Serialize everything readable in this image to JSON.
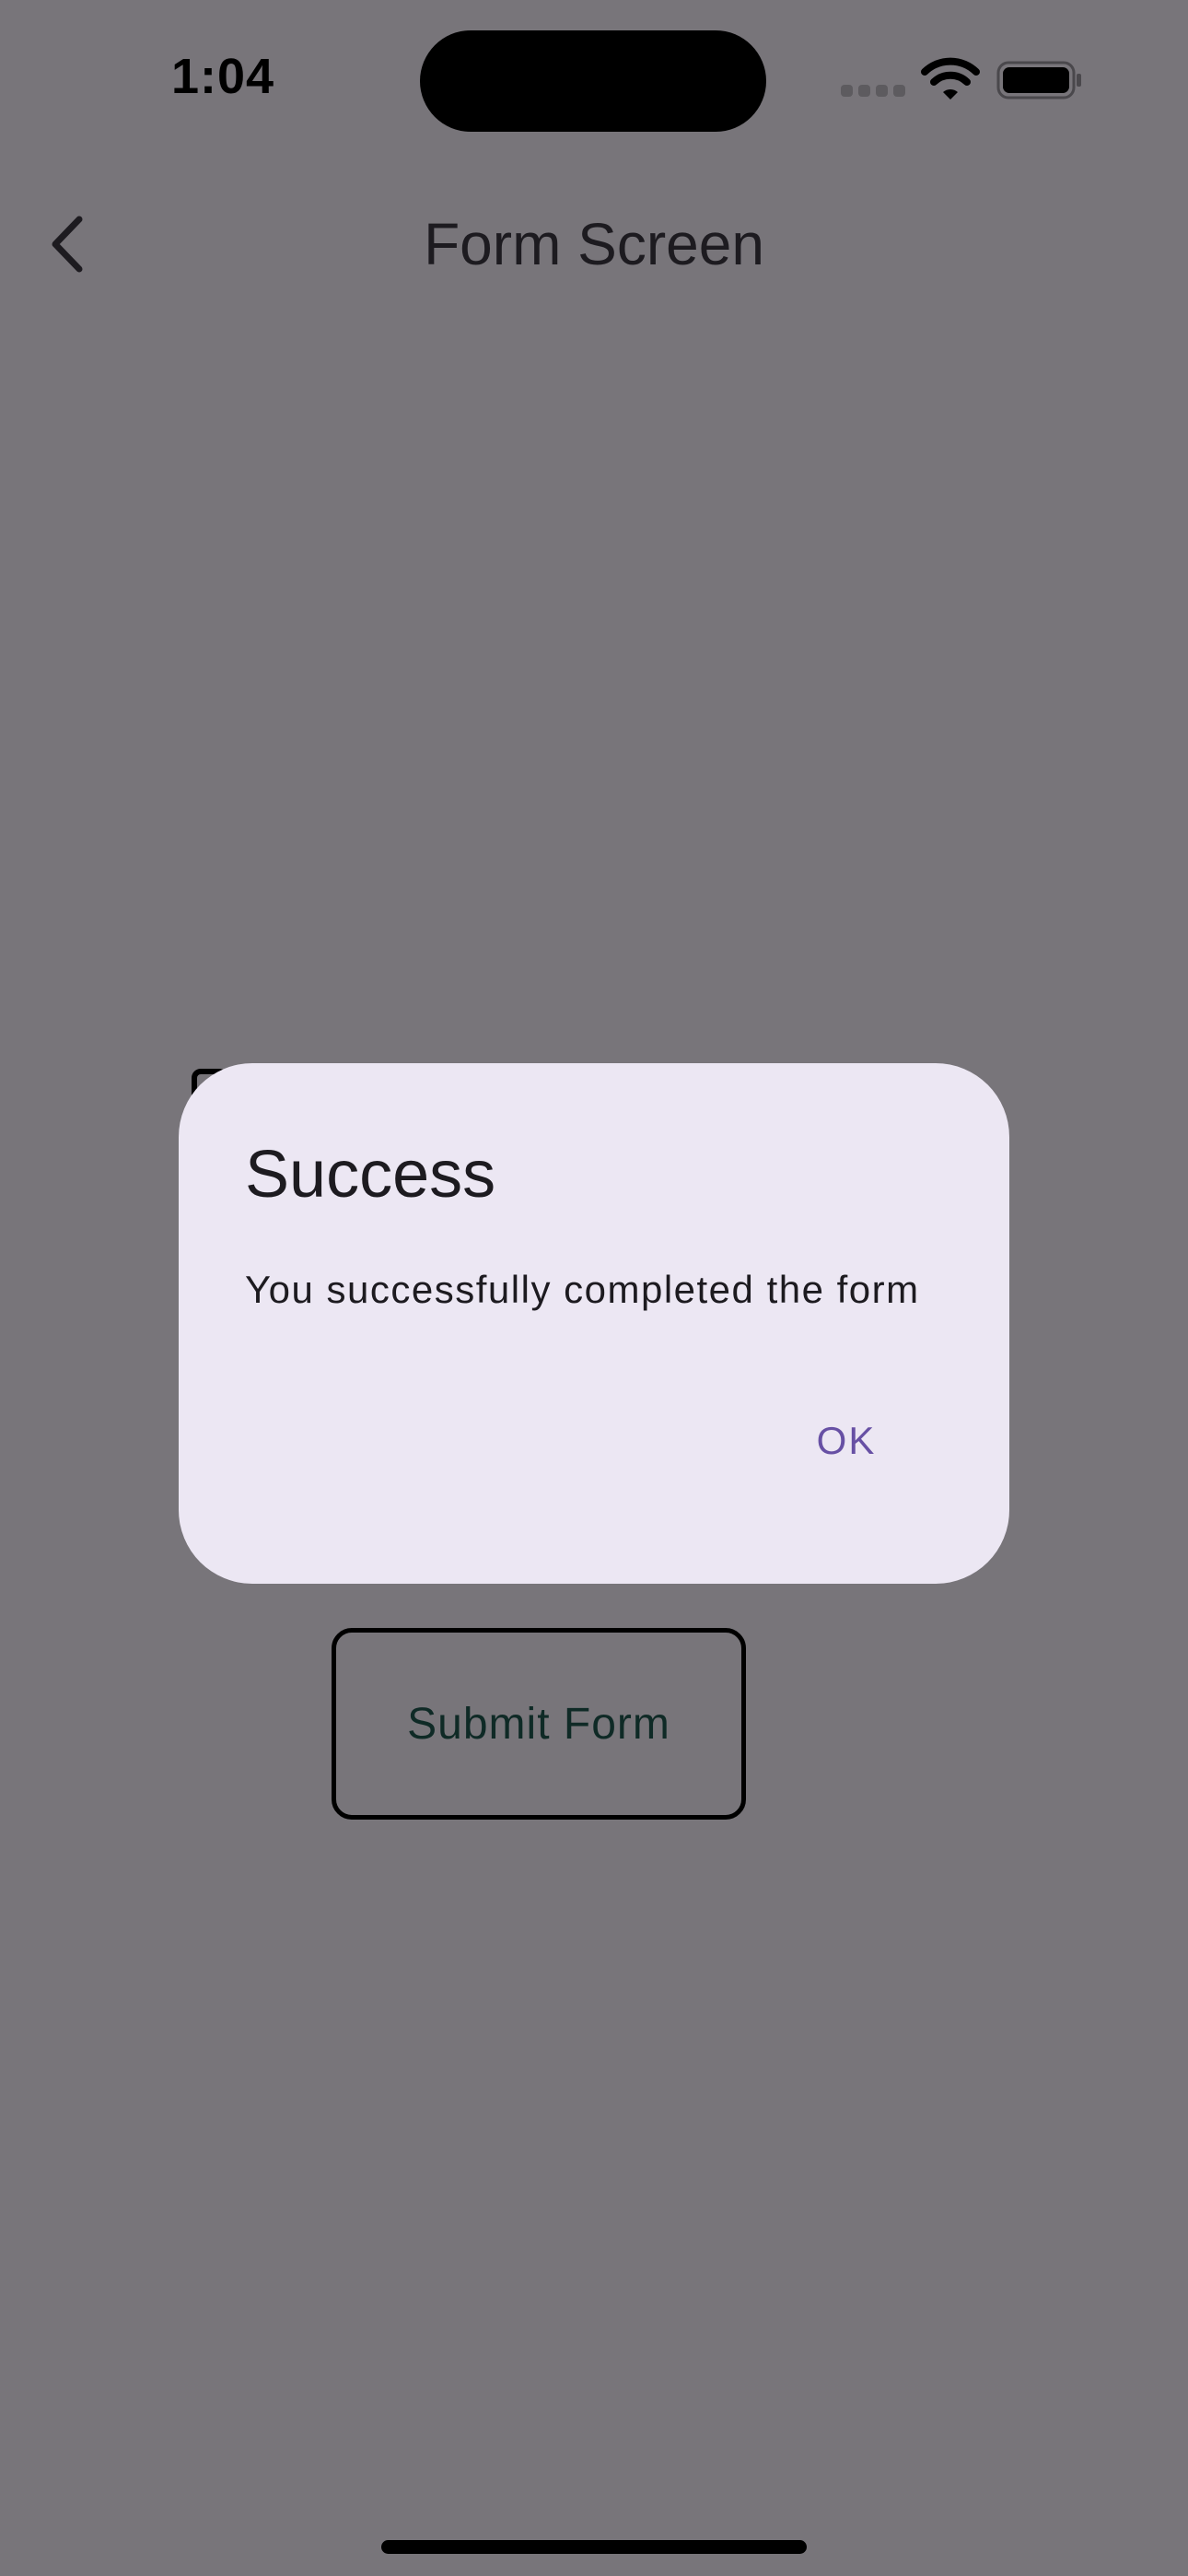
{
  "status_bar": {
    "time": "1:04",
    "icons": [
      "signal-icon",
      "wifi-icon",
      "battery-icon"
    ]
  },
  "nav": {
    "back_icon": "chevron-left-icon",
    "title": "Form Screen"
  },
  "form": {
    "submit_label": "Submit Form"
  },
  "dialog": {
    "title": "Success",
    "message": "You successfully completed the form",
    "ok_label": "OK"
  },
  "colors": {
    "scrim_background": "#78757a",
    "dialog_surface": "#ece7f3",
    "dialog_action": "#6750a4",
    "text_primary": "#1d1b20"
  }
}
